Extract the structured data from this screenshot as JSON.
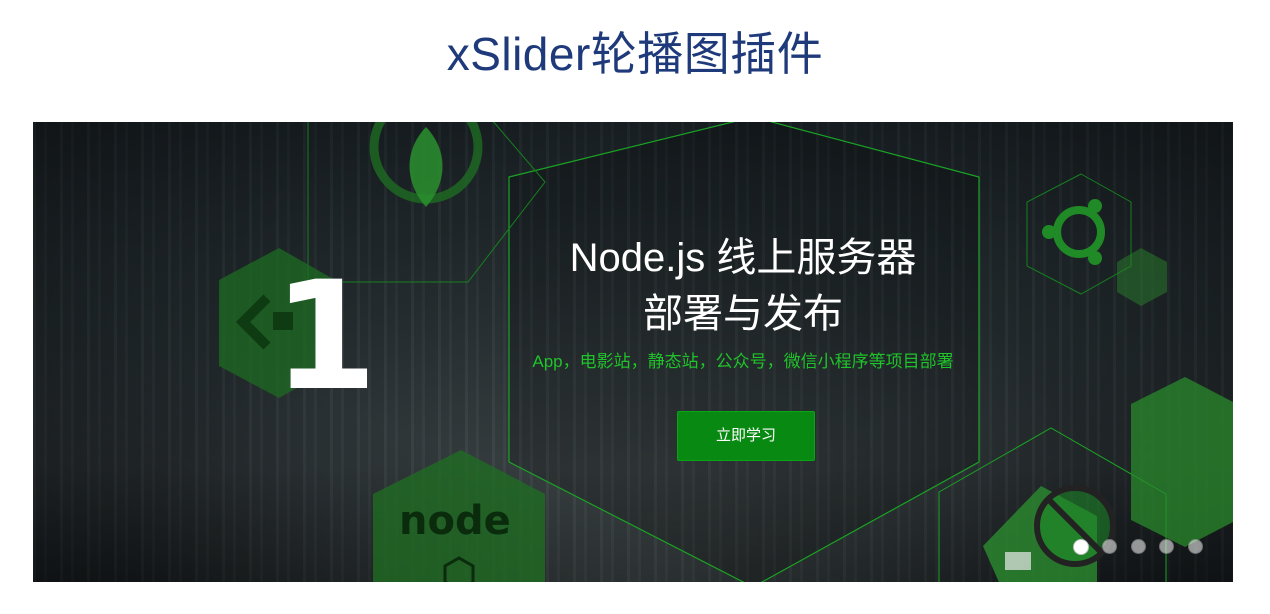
{
  "page": {
    "title": "xSlider轮播图插件"
  },
  "slider": {
    "slide_number": "1",
    "headline_line1": "Node.js 线上服务器",
    "headline_line2": "部署与发布",
    "subline": "App，电影站，静态站，公众号，微信小程序等项目部署",
    "cta_label": "立即学习",
    "active_index": 0,
    "dot_count": 5,
    "accent_color": "#1fc32a",
    "button_color": "#088a12",
    "icons": [
      "mongodb-leaf-icon",
      "ubuntu-icon",
      "nodejs-logo-icon",
      "code-icon",
      "no-hands-sign-icon"
    ]
  }
}
